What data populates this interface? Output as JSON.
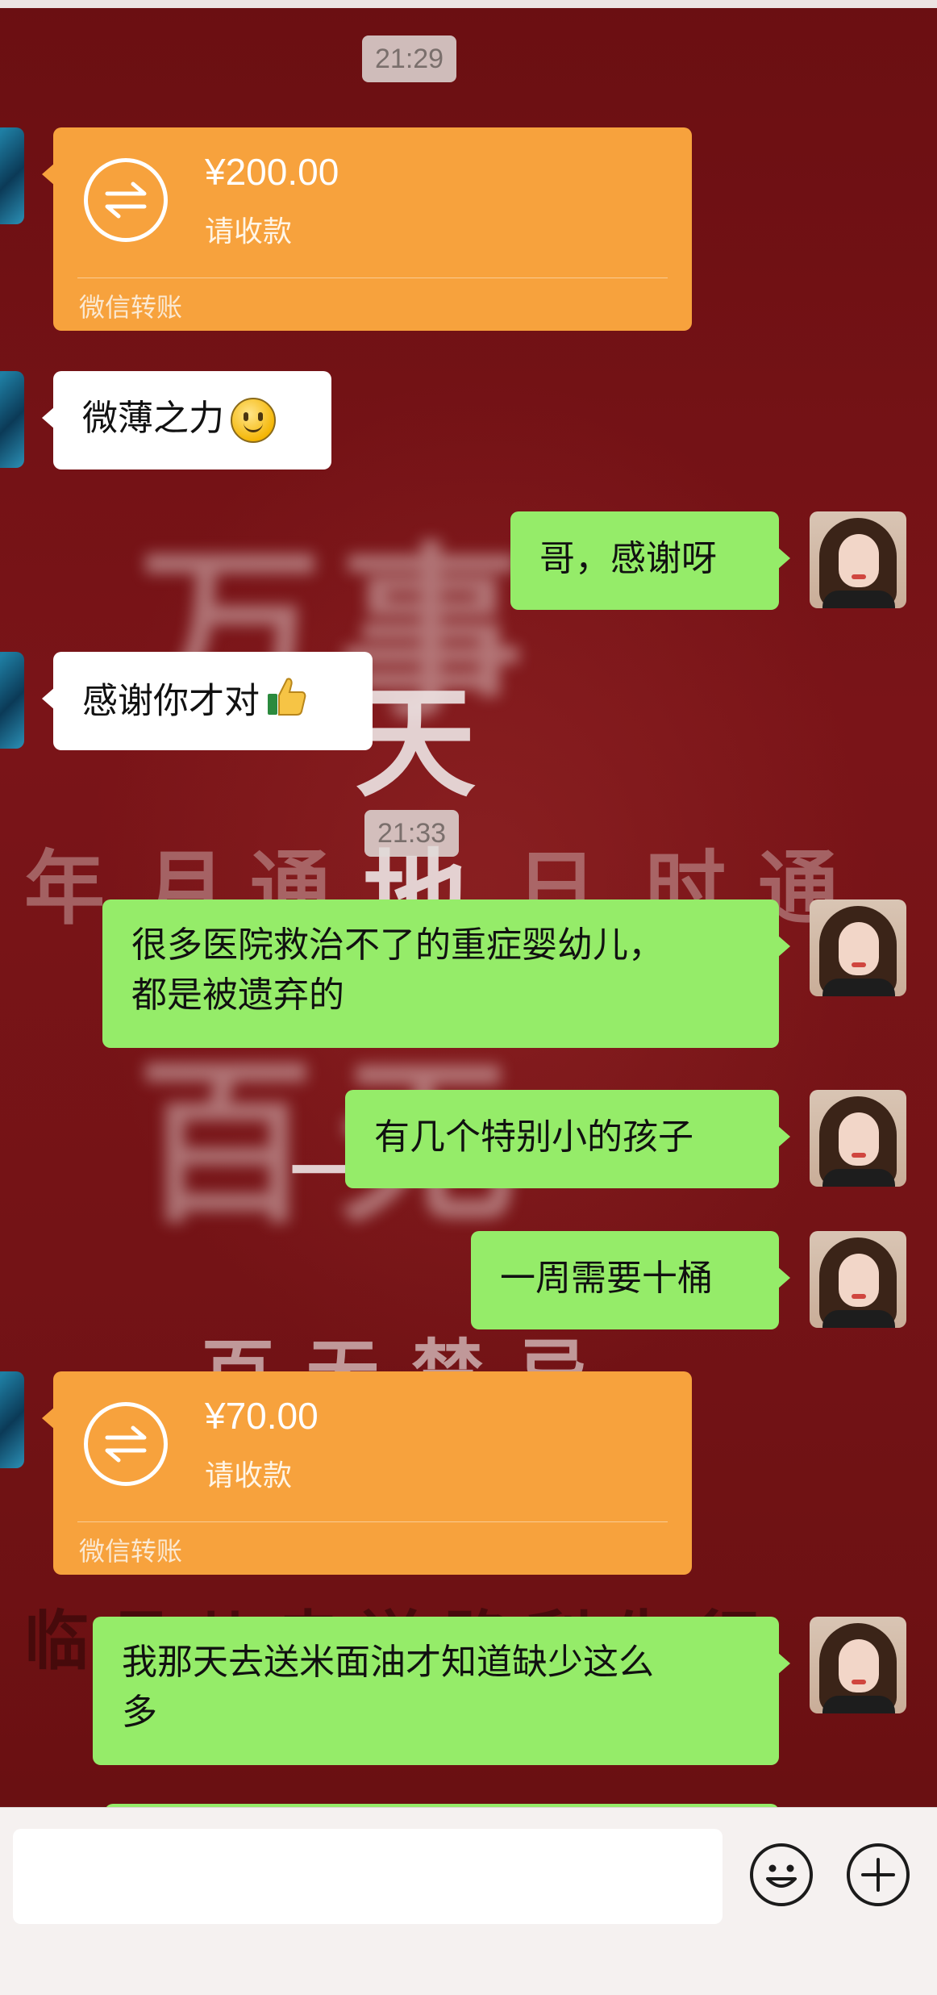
{
  "wallpaper": {
    "blurred_top": "万事",
    "sky": "天",
    "row": [
      "年",
      "月",
      "通",
      "地",
      "日",
      "时",
      "通"
    ],
    "blurred_mid": "百无",
    "dash": "一",
    "bottom_line": "百无禁忌",
    "dark_line": "临月儿走送路利先行"
  },
  "timestamps": [
    "21:29",
    "21:33"
  ],
  "transfers": [
    {
      "amount": "¥200.00",
      "status": "请收款",
      "label": "微信转账"
    },
    {
      "amount": "¥70.00",
      "status": "请收款",
      "label": "微信转账"
    }
  ],
  "messages": [
    {
      "side": "left",
      "text": "微薄之力"
    },
    {
      "side": "right",
      "text": "哥，感谢呀"
    },
    {
      "side": "left",
      "text": "感谢你才对"
    },
    {
      "side": "right",
      "lines": [
        "很多医院救治不了的重症婴幼儿，",
        "都是被遗弃的"
      ]
    },
    {
      "side": "right",
      "text": "有几个特别小的孩子"
    },
    {
      "side": "right",
      "text": "一周需要十桶"
    },
    {
      "side": "right",
      "lines": [
        "我那天去送米面油才知道缺少这么",
        "多"
      ]
    }
  ],
  "icons": {
    "smile_emoji": "smile-emoji-icon",
    "thumbs_up": "thumbs-up-icon",
    "transfer": "transfer-arrows-icon",
    "emoji_button": "emoji-icon",
    "plus_button": "plus-icon"
  },
  "colors": {
    "green_bubble": "#95ec69",
    "transfer_orange": "#f7a23d",
    "wallpaper_red": "#7a1418"
  },
  "input": {
    "value": "",
    "placeholder": ""
  }
}
